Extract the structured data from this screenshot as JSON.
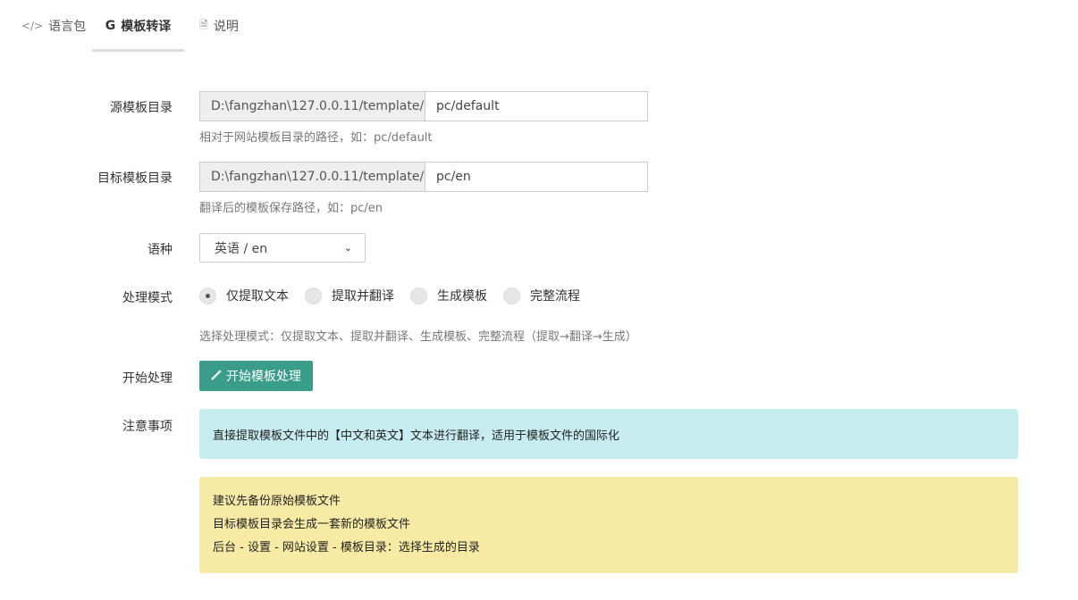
{
  "tabs": [
    {
      "icon": "code-icon",
      "glyph": "</>",
      "label": "语言包",
      "active": false
    },
    {
      "icon": "google-icon",
      "glyph": "G",
      "label": "模板转译",
      "active": true
    },
    {
      "icon": "file-icon",
      "glyph": "🗎",
      "label": "说明",
      "active": false
    }
  ],
  "form": {
    "source_dir": {
      "label": "源模板目录",
      "prefix": "D:\\fangzhan\\127.0.0.11/template/",
      "value": "pc/default",
      "help": "相对于网站模板目录的路径，如：pc/default"
    },
    "target_dir": {
      "label": "目标模板目录",
      "prefix": "D:\\fangzhan\\127.0.0.11/template/",
      "value": "pc/en",
      "help": "翻译后的模板保存路径，如：pc/en"
    },
    "language": {
      "label": "语种",
      "selected": "英语 / en"
    },
    "mode": {
      "label": "处理模式",
      "options": [
        "仅提取文本",
        "提取并翻译",
        "生成模板",
        "完整流程"
      ],
      "selected_index": 0,
      "help": "选择处理模式：仅提取文本、提取并翻译、生成模板、完整流程（提取→翻译→生成）"
    },
    "start": {
      "label": "开始处理",
      "button": "开始模板处理",
      "button_icon": "magic-wand-icon",
      "button_color": "#3a9d8a"
    },
    "notes": {
      "label": "注意事项",
      "info": "直接提取模板文件中的【中文和英文】文本进行翻译，适用于模板文件的国际化",
      "warnings": [
        "建议先备份原始模板文件",
        "目标模板目录会生成一套新的模板文件",
        "后台 - 设置 - 网站设置 - 模板目录：选择生成的目录"
      ]
    }
  }
}
